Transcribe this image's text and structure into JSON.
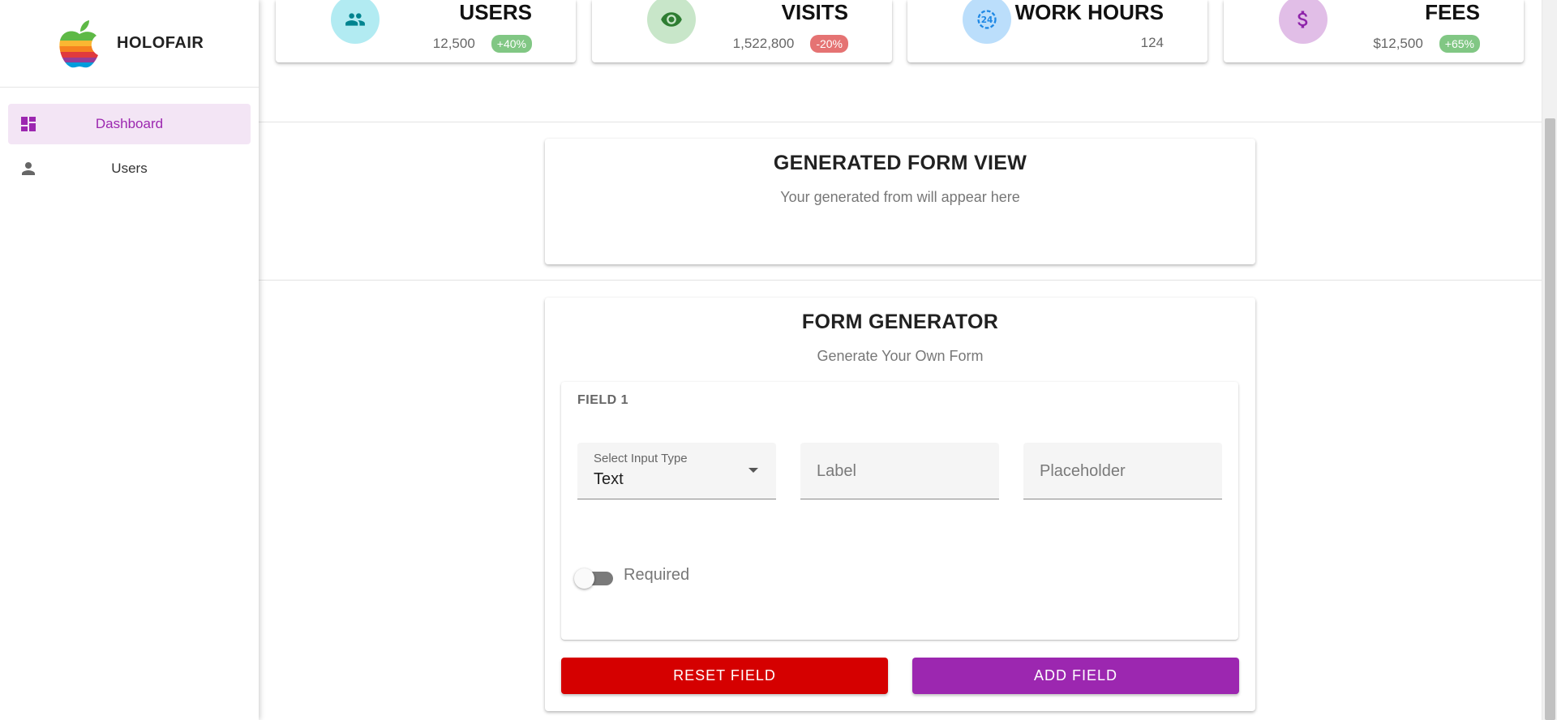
{
  "brand": {
    "name": "HOLOFAIR",
    "logo": "apple-rainbow-logo"
  },
  "sidebar": {
    "items": [
      {
        "label": "Dashboard",
        "icon": "dashboard-icon",
        "active": true
      },
      {
        "label": "Users",
        "icon": "person-icon",
        "active": false
      }
    ]
  },
  "stats": [
    {
      "title": "USERS",
      "value": "12,500",
      "badge": "+40%",
      "badge_color": "#81c784",
      "icon": "people-icon",
      "icon_bg": "#b2ebf2",
      "icon_color": "#00838f"
    },
    {
      "title": "VISITS",
      "value": "1,522,800",
      "badge": "-20%",
      "badge_color": "#e57373",
      "icon": "eye-icon",
      "icon_bg": "#c8e6c9",
      "icon_color": "#2e7d32"
    },
    {
      "title": "WORK HOURS",
      "value": "124",
      "badge": "",
      "badge_color": "",
      "icon": "24-hours-icon",
      "icon_bg": "#bbdefb",
      "icon_color": "#1e88e5"
    },
    {
      "title": "FEES",
      "value": "$12,500",
      "badge": "+65%",
      "badge_color": "#81c784",
      "icon": "dollar-icon",
      "icon_bg": "#e1bee7",
      "icon_color": "#8e24aa"
    }
  ],
  "form_view": {
    "title": "GENERATED FORM VIEW",
    "subtitle": "Your generated from will appear here"
  },
  "form_generator": {
    "title": "FORM GENERATOR",
    "subtitle": "Generate Your Own Form",
    "field": {
      "heading": "FIELD 1",
      "input_type": {
        "label": "Select Input Type",
        "value": "Text"
      },
      "label_placeholder": "Label",
      "placeholder_placeholder": "Placeholder",
      "required_label": "Required",
      "required": false
    },
    "buttons": {
      "reset": "RESET FIELD",
      "add": "ADD FIELD"
    }
  },
  "colors": {
    "accent": "#9c27b0",
    "reset": "#d50000",
    "add": "#9c27b0"
  }
}
